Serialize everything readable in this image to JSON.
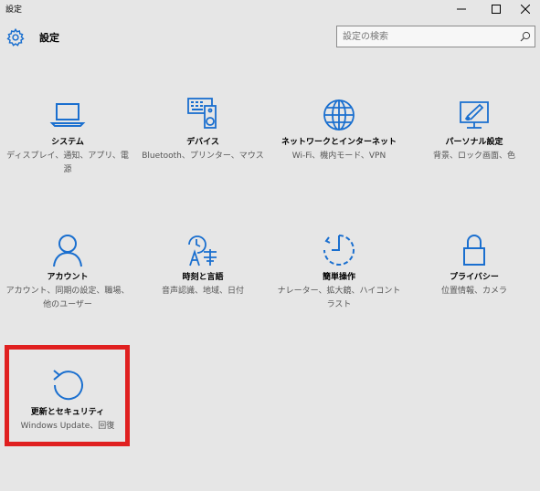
{
  "window": {
    "title": "設定",
    "minimize_glyph": "—",
    "maximize_glyph": "☐",
    "close_glyph": "✕"
  },
  "header": {
    "title": "設定",
    "icon": "gear-icon",
    "search_placeholder": "設定の検索",
    "search_value": ""
  },
  "accent_color": "#1a6fcf",
  "highlight_color": "#e02020",
  "tiles": [
    {
      "label": "システム",
      "desc": "ディスプレイ、通知、アプリ、電源",
      "icon": "laptop-icon"
    },
    {
      "label": "デバイス",
      "desc": "Bluetooth、プリンター、マウス",
      "icon": "devices-icon"
    },
    {
      "label": "ネットワークとインターネット",
      "desc": "Wi-Fi、機内モード、VPN",
      "icon": "globe-icon"
    },
    {
      "label": "パーソナル設定",
      "desc": "背景、ロック画面、色",
      "icon": "paint-icon"
    },
    {
      "label": "アカウント",
      "desc": "アカウント、同期の設定、職場、他のユーザー",
      "icon": "person-icon"
    },
    {
      "label": "時刻と言語",
      "desc": "音声認識、地域、日付",
      "icon": "time-language-icon"
    },
    {
      "label": "簡単操作",
      "desc": "ナレーター、拡大鏡、ハイコントラスト",
      "icon": "ease-of-access-icon"
    },
    {
      "label": "プライバシー",
      "desc": "位置情報、カメラ",
      "icon": "lock-icon"
    },
    {
      "label": "更新とセキュリティ",
      "desc": "Windows Update、回復",
      "icon": "update-icon"
    }
  ]
}
